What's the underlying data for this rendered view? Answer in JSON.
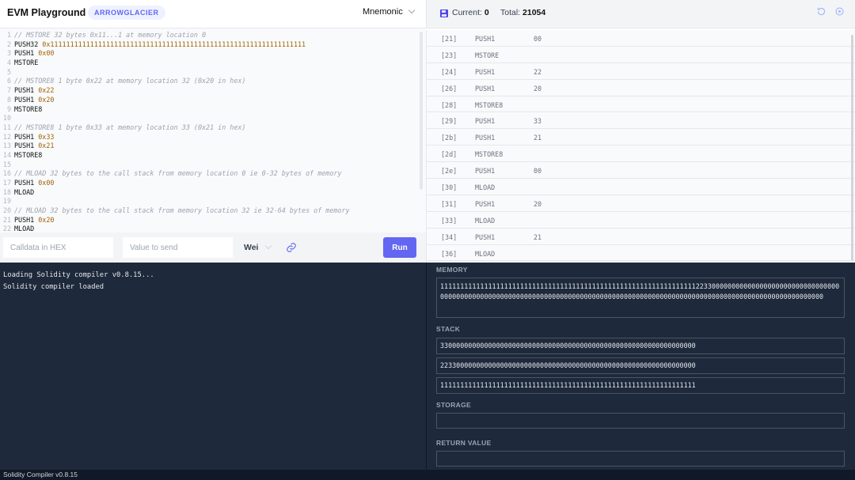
{
  "header": {
    "title": "EVM Playground",
    "fork": "ARROWGLACIER",
    "mode": "Mnemonic"
  },
  "editor": {
    "lines": [
      {
        "n": "1",
        "parts": [
          {
            "t": "// MSTORE 32 bytes 0x11...1 at memory location 0",
            "c": "cmt"
          }
        ]
      },
      {
        "n": "2",
        "parts": [
          {
            "t": "PUSH32 ",
            "c": "op"
          },
          {
            "t": "0x1111111111111111111111111111111111111111111111111111111111111111",
            "c": "hex"
          }
        ]
      },
      {
        "n": "3",
        "parts": [
          {
            "t": "PUSH1 ",
            "c": "op"
          },
          {
            "t": "0x00",
            "c": "hex"
          }
        ]
      },
      {
        "n": "4",
        "parts": [
          {
            "t": "MSTORE",
            "c": "op"
          }
        ]
      },
      {
        "n": "5",
        "parts": []
      },
      {
        "n": "6",
        "parts": [
          {
            "t": "// MSTORE8 1 byte 0x22 at memory location 32 (0x20 in hex)",
            "c": "cmt"
          }
        ]
      },
      {
        "n": "7",
        "parts": [
          {
            "t": "PUSH1 ",
            "c": "op"
          },
          {
            "t": "0x22",
            "c": "hex"
          }
        ]
      },
      {
        "n": "8",
        "parts": [
          {
            "t": "PUSH1 ",
            "c": "op"
          },
          {
            "t": "0x20",
            "c": "hex"
          }
        ]
      },
      {
        "n": "9",
        "parts": [
          {
            "t": "MSTORE8",
            "c": "op"
          }
        ]
      },
      {
        "n": "10",
        "parts": []
      },
      {
        "n": "11",
        "parts": [
          {
            "t": "// MSTORE8 1 byte 0x33 at memory location 33 (0x21 in hex)",
            "c": "cmt"
          }
        ]
      },
      {
        "n": "12",
        "parts": [
          {
            "t": "PUSH1 ",
            "c": "op"
          },
          {
            "t": "0x33",
            "c": "hex"
          }
        ]
      },
      {
        "n": "13",
        "parts": [
          {
            "t": "PUSH1 ",
            "c": "op"
          },
          {
            "t": "0x21",
            "c": "hex"
          }
        ]
      },
      {
        "n": "14",
        "parts": [
          {
            "t": "MSTORE8",
            "c": "op"
          }
        ]
      },
      {
        "n": "15",
        "parts": []
      },
      {
        "n": "16",
        "parts": [
          {
            "t": "// MLOAD 32 bytes to the call stack from memory location 0 ie 0-32 bytes of memory",
            "c": "cmt"
          }
        ]
      },
      {
        "n": "17",
        "parts": [
          {
            "t": "PUSH1 ",
            "c": "op"
          },
          {
            "t": "0x00",
            "c": "hex"
          }
        ]
      },
      {
        "n": "18",
        "parts": [
          {
            "t": "MLOAD",
            "c": "op"
          }
        ]
      },
      {
        "n": "19",
        "parts": []
      },
      {
        "n": "20",
        "parts": [
          {
            "t": "// MLOAD 32 bytes to the call stack from memory location 32 ie 32-64 bytes of memory",
            "c": "cmt"
          }
        ]
      },
      {
        "n": "21",
        "parts": [
          {
            "t": "PUSH1 ",
            "c": "op"
          },
          {
            "t": "0x20",
            "c": "hex"
          }
        ]
      },
      {
        "n": "22",
        "parts": [
          {
            "t": "MLOAD",
            "c": "op"
          }
        ]
      }
    ]
  },
  "inputs": {
    "calldata_placeholder": "Calldata in HEX",
    "value_placeholder": "Value to send",
    "unit": "Wei",
    "run_label": "Run"
  },
  "execution": {
    "current_label": "Current:",
    "current_value": "0",
    "total_label": "Total:",
    "total_value": "21054",
    "rows": [
      {
        "pc": "[21]",
        "op": "PUSH1",
        "arg": "00"
      },
      {
        "pc": "[23]",
        "op": "MSTORE",
        "arg": ""
      },
      {
        "pc": "[24]",
        "op": "PUSH1",
        "arg": "22"
      },
      {
        "pc": "[26]",
        "op": "PUSH1",
        "arg": "20"
      },
      {
        "pc": "[28]",
        "op": "MSTORE8",
        "arg": ""
      },
      {
        "pc": "[29]",
        "op": "PUSH1",
        "arg": "33"
      },
      {
        "pc": "[2b]",
        "op": "PUSH1",
        "arg": "21"
      },
      {
        "pc": "[2d]",
        "op": "MSTORE8",
        "arg": ""
      },
      {
        "pc": "[2e]",
        "op": "PUSH1",
        "arg": "00"
      },
      {
        "pc": "[30]",
        "op": "MLOAD",
        "arg": ""
      },
      {
        "pc": "[31]",
        "op": "PUSH1",
        "arg": "20"
      },
      {
        "pc": "[33]",
        "op": "MLOAD",
        "arg": ""
      },
      {
        "pc": "[34]",
        "op": "PUSH1",
        "arg": "21"
      },
      {
        "pc": "[36]",
        "op": "MLOAD",
        "arg": ""
      }
    ]
  },
  "console": {
    "lines": [
      "Loading Solidity compiler v0.8.15...",
      "Solidity compiler loaded"
    ]
  },
  "state": {
    "memory_label": "MEMORY",
    "memory_value": "1111111111111111111111111111111111111111111111111111111111111111223300000000000000000000000000000000000000000000000000000000000000000000000000000000000000000000000000000000000000000000000000000000",
    "stack_label": "STACK",
    "stack": [
      "3300000000000000000000000000000000000000000000000000000000000000",
      "2233000000000000000000000000000000000000000000000000000000000000",
      "1111111111111111111111111111111111111111111111111111111111111111"
    ],
    "storage_label": "STORAGE",
    "return_label": "RETURN VALUE"
  },
  "footer": {
    "status": "Solidity Compiler v0.8.15"
  },
  "colors": {
    "accent": "#6366f1",
    "console_bg": "#1e293b",
    "hex_literal": "#a16207"
  }
}
